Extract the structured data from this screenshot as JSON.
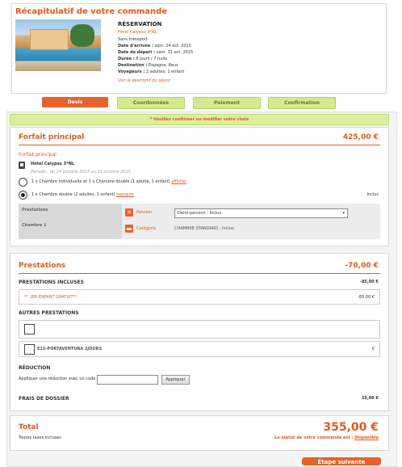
{
  "summary": {
    "title": "Récapitulatif de votre commande",
    "heading": "RÉSERVATION",
    "hotel": "Hôtel Calypso 3*NL",
    "transport": "Sans transport",
    "arrival_label": "Date d'arrivée :",
    "arrival_value": "sam. 24 oct. 2015",
    "departure_label": "Date de départ :",
    "departure_value": "sam. 31 oct. 2015",
    "duration_label": "Durée :",
    "duration_value": "8 jours / 7 nuits",
    "destination_label": "Destination :",
    "destination_value": "Espagne, Reus",
    "travelers_label": "Voyageurs :",
    "travelers_value": "2 adultes, 1 enfant",
    "detail_link": "Voir le descriptif du séjour"
  },
  "steps": [
    "Devis",
    "Coordonnées",
    "Paiement",
    "Confirmation"
  ],
  "notice": "* Veuillez confirmer ou modifier votre choix",
  "forfait": {
    "title": "Forfait principal",
    "price": "425,00 €",
    "sublabel": "Forfait principal",
    "hotel_name": "Hôtel Calypso 3*NL",
    "dates": "Période : du 24 octobre 2015 au 31 octobre 2015",
    "option1": "1 x Chambre individuelle et 1 x Chambre double (1 adulte, 1 enfant)",
    "option1_link": "afficher",
    "option2": "1 x Chambre double (2 adultes, 1 enfant)",
    "option2_link": "masquer",
    "included": "Inclus",
    "prestations_label": "Prestations",
    "chambre_label": "Chambre 1",
    "pension_label": "Pension",
    "pension_value": "Demi-pension : Inclus",
    "categorie_label": "Catégorie",
    "categorie_value": "CHAMBRE STANDARD : Inclus"
  },
  "prestations": {
    "title": "Prestations",
    "price": "-70,00 €",
    "included_title": "PRESTATIONS INCLUSES",
    "included_price": "-85,00 €",
    "child_label": "** 1ER ENFANT GRATUIT**",
    "child_price": "-85,00 €",
    "others_title": "AUTRES PRESTATIONS",
    "item_label": "E15-PORTAVENTURA 2JOURS",
    "item_price": "€",
    "reduction_title": "RÉDUCTION",
    "reduction_label": "Appliquer une réduction avec un code",
    "apply_button": "Appliquer",
    "fees_label": "FRAIS DE DOSSIER",
    "fees_value": "15,00 €"
  },
  "total": {
    "label": "Total",
    "sub": "Toutes taxes incluses",
    "value": "355,00 €",
    "status_prefix": "Le statut de votre commande est :",
    "status_value": "Disponible"
  },
  "next_button": "Étape suivante"
}
